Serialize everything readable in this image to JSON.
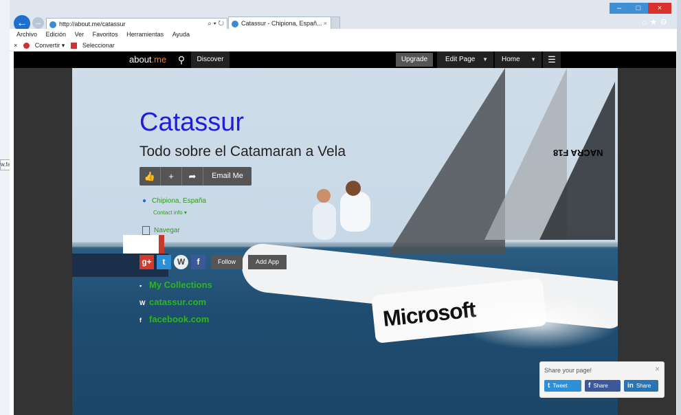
{
  "browser": {
    "address_url": "http://about.me/catassur",
    "tab_title": "Catassur - Chipiona, Españ...",
    "tab_close": "×",
    "left_tab_text": "w.fa",
    "menu": [
      "Archivo",
      "Edición",
      "Ver",
      "Favoritos",
      "Herramientas",
      "Ayuda"
    ],
    "cmd": {
      "close": "×",
      "convert": "Convertir",
      "select": "Seleccionar"
    }
  },
  "topbar": {
    "logo_main": "about",
    "logo_accent": ".me",
    "discover": "Discover",
    "upgrade": "Upgrade",
    "edit_page": "Edit Page",
    "home": "Home"
  },
  "profile": {
    "name": "Catassur",
    "headline": "Todo sobre el Catamaran a Vela",
    "email_button": "Email Me",
    "location": "Chipiona, España",
    "contact_info": "Contact info",
    "navegar": "Navegar",
    "follow": "Follow",
    "add_app": "Add App",
    "links": [
      "My Collections",
      "catassur.com",
      "facebook.com"
    ]
  },
  "hero": {
    "hull_text": "Microsoft",
    "sail_mark": "NACRA F18"
  },
  "share": {
    "prompt": "Share your page!",
    "tweet": "Tweet",
    "fb_share": "Share",
    "in_share": "Share"
  },
  "colors": {
    "accent": "#f07d1a",
    "name": "#1e1ee0",
    "link_green": "#2db51c"
  },
  "icons": [
    "back-arrow-icon",
    "forward-arrow-icon",
    "search-icon",
    "thumbs-up-icon",
    "plus-icon",
    "share-arrow-icon",
    "location-pin-icon",
    "map-icon",
    "google-plus-icon",
    "twitter-icon",
    "wordpress-icon",
    "facebook-icon",
    "menu-icon"
  ]
}
